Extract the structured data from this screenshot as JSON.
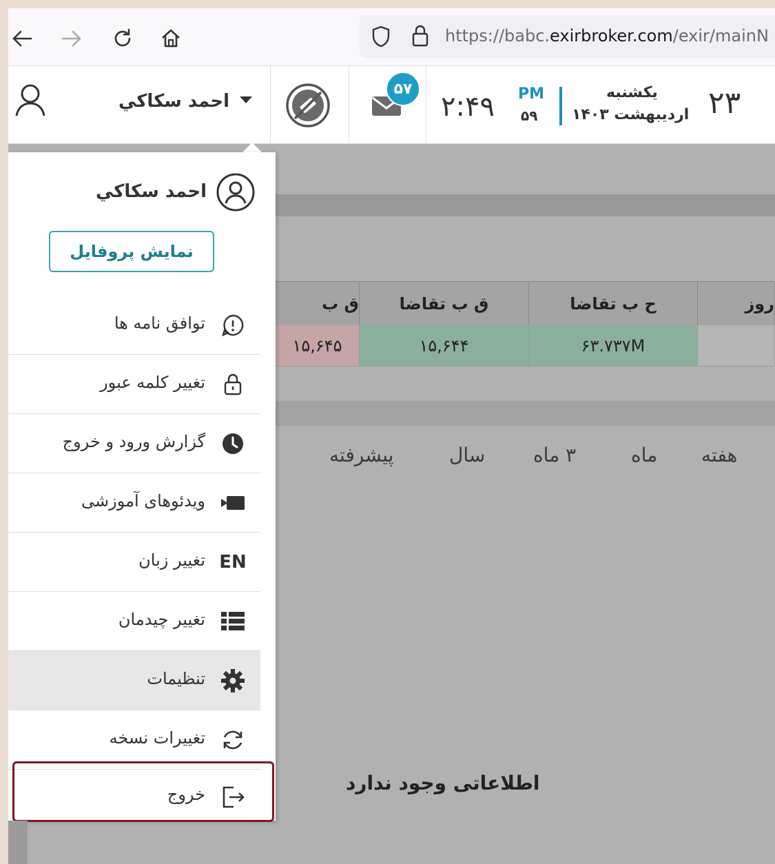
{
  "browser": {
    "back_icon": "arrow-left-icon",
    "forward_icon": "arrow-right-icon",
    "reload_icon": "reload-icon",
    "home_icon": "home-icon",
    "url_prefix": "https://babc.",
    "url_host": "exirbroker.com",
    "url_path": "/exir/mainN"
  },
  "header": {
    "user_name": "احمد سكاكي",
    "unread_count": "۵۷",
    "time": "۲:۴۹",
    "ampm": "PM",
    "seconds": "۵۹",
    "weekday": "یکشنبه",
    "month_year": "اردیبهشت ۱۴۰۳",
    "day": "۲۳"
  },
  "dropdown": {
    "user_name": "احمد سكاكي",
    "profile_button": "نمایش پروفایل",
    "items": [
      {
        "label": "توافق نامه ها",
        "icon": "agreement-icon"
      },
      {
        "label": "تغییر کلمه عبور",
        "icon": "lock-icon"
      },
      {
        "label": "گزارش ورود و خروج",
        "icon": "clock-icon"
      },
      {
        "label": "ویدئوهای آموزشی",
        "icon": "video-icon"
      },
      {
        "label": "تغییر زبان",
        "icon": "language-icon",
        "icon_text": "EN"
      },
      {
        "label": "تغییر چیدمان",
        "icon": "layout-icon"
      },
      {
        "label": "تنظیمات",
        "icon": "gear-icon"
      },
      {
        "label": "تغییرات نسخه",
        "icon": "refresh-icon"
      },
      {
        "label": "خروج",
        "icon": "logout-icon"
      }
    ]
  },
  "table": {
    "headers": [
      "روز",
      "ح ب تقاضا",
      "ق ب تقاضا",
      "ق ب"
    ],
    "row": [
      "",
      "۶۳.۷۳۷M",
      "۱۵,۶۴۴",
      "۱۵,۶۴۵"
    ],
    "colors": {
      "green_cell": "#8ab09d",
      "red_cell": "#c4a4a4"
    }
  },
  "periods": [
    "هفته",
    "ماه",
    "۳ ماه",
    "سال",
    "پیشرفته"
  ],
  "no_data": "اطلاعاتی وجود ندارد",
  "colors": {
    "accent": "#1f9dc9",
    "profile_border": "#3ca3b2",
    "logout_highlight": "#7f1820"
  }
}
